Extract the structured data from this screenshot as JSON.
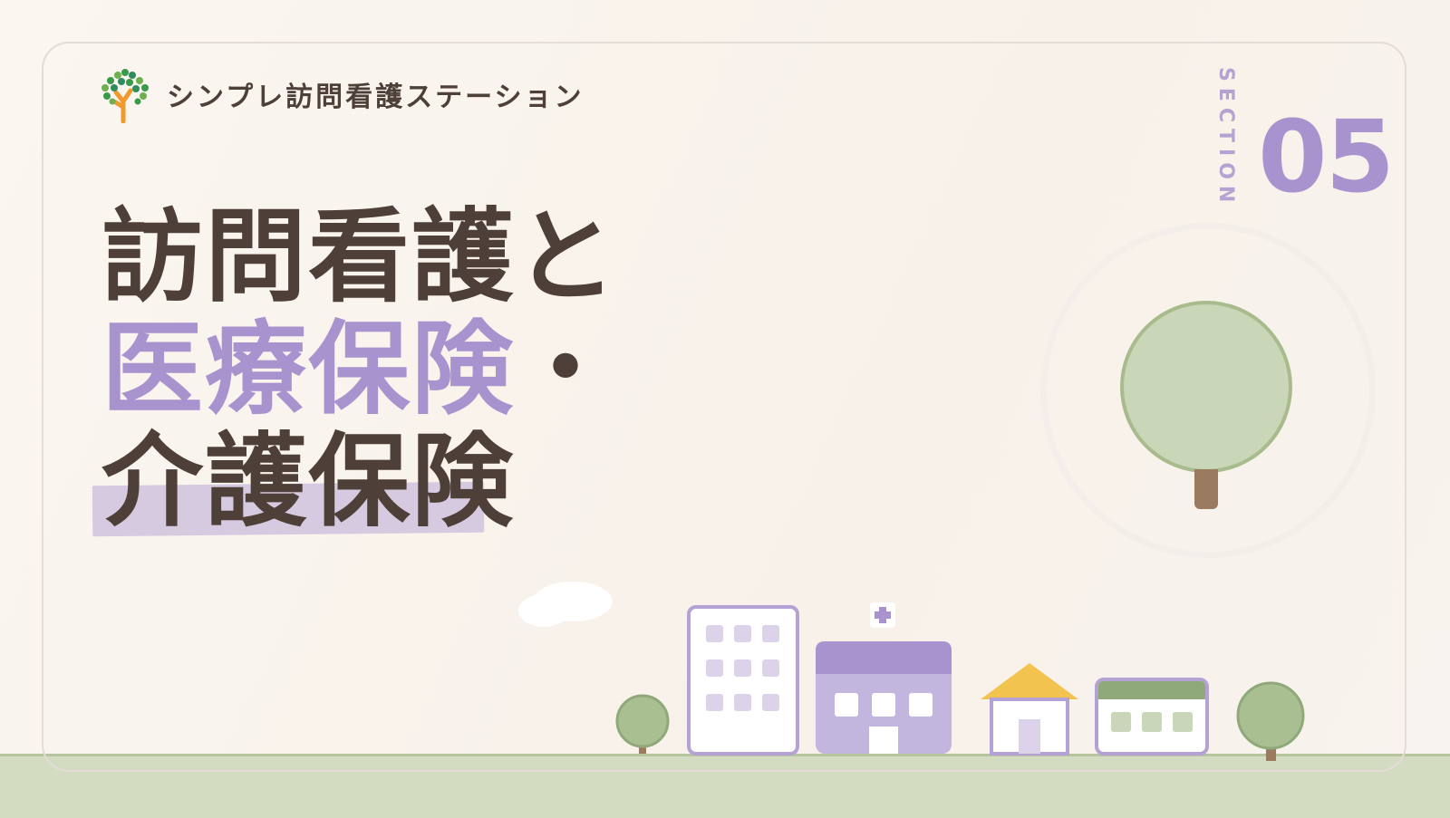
{
  "brand": {
    "name": "シンプレ訪問看護ステーション",
    "logo_icon": "tree-logo-icon"
  },
  "section": {
    "label": "SECTION",
    "number": "05"
  },
  "title": {
    "line1": "訪問看護と",
    "line2": "医療保険",
    "line2_dot": "・",
    "line3": "介護保険"
  },
  "colors": {
    "accent_purple": "#a893cf",
    "text_brown": "#4e4038",
    "tree_green": "#c9d6b7",
    "ground_green": "#d3dbc1",
    "roof_yellow": "#f2c44f"
  },
  "illustration": {
    "icons": [
      "tree-icon",
      "apartment-building-icon",
      "hospital-icon",
      "house-icon",
      "shop-icon",
      "cloud-icon"
    ]
  }
}
